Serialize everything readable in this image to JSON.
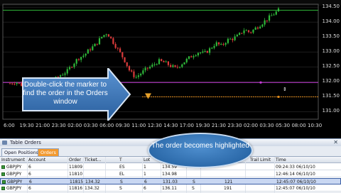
{
  "chart_data": {
    "type": "candlestick",
    "y_ticks": [
      "134.50",
      "134.00",
      "133.50",
      "133.00",
      "132.50",
      "132.00",
      "131.50",
      "131.00"
    ],
    "x_ticks": [
      "6:00",
      "19:30",
      "21:00",
      "23:30",
      "02:00",
      "03:30",
      "06:00",
      "09:30",
      "11:00",
      "12:30",
      "14:30",
      "17:00",
      "19:30",
      "21:30",
      "23:30",
      "02:00",
      "03:30",
      "05:30",
      "08:00",
      "10:30"
    ],
    "close_path": [
      131.95,
      132.0,
      131.9,
      131.85,
      131.95,
      132.05,
      131.9,
      131.85,
      132.1,
      132.25,
      132.35,
      132.6,
      132.8,
      132.9,
      133.1,
      133.25,
      133.5,
      133.65,
      133.35,
      133.05,
      132.75,
      132.35,
      132.15,
      132.3,
      132.45,
      132.55,
      132.7,
      132.65,
      132.55,
      132.45,
      132.6,
      132.75,
      132.9,
      133.0,
      132.95,
      133.1,
      133.3,
      133.2,
      133.4,
      133.45,
      133.55,
      133.75,
      133.65,
      133.8,
      133.95,
      134.1,
      134.25,
      134.4
    ],
    "order_marker_price": 131.5,
    "order_line_price": 131.5,
    "pink_line_price": 131.98,
    "green_line_price": 134.4,
    "colors": {
      "up": "#2fb83a",
      "down": "#d93b3b",
      "order_line": "#e08a1a",
      "pink_line": "#c63ad8",
      "green_line": "#2fb83a",
      "marker": "#e6a12b"
    }
  },
  "panel": {
    "title": "Table Orders",
    "tabs": [
      "Open Positions",
      "Orders"
    ],
    "active_tab": "Orders",
    "columns": [
      "Instrument",
      "Account",
      "Order",
      "Ticket...",
      "T",
      "Lot",
      "",
      "",
      "",
      "",
      "",
      "Trail Limit",
      "Time"
    ],
    "rows": [
      {
        "instrument": "GBPJPY",
        "account": "6",
        "order": "11809",
        "ticket": "",
        "type": "ES",
        "lot": "1",
        "price": "134.59",
        "side": "",
        "extra": "",
        "time": "09:24:33 06/10/10",
        "highlight": false
      },
      {
        "instrument": "GBPJPY",
        "account": "6",
        "order": "11810",
        "ticket": "",
        "type": "EL",
        "lot": "1",
        "price": "134.98",
        "side": "",
        "extra": "",
        "time": "12:46:14 06/10/10",
        "highlight": false
      },
      {
        "instrument": "GBPJPY",
        "account": "6",
        "order": "11815",
        "ticket": "134.32",
        "type": "S",
        "lot": "6",
        "price": "131.03",
        "side": "S",
        "extra": "121",
        "time": "12:45:07 06/10/10",
        "highlight": true
      },
      {
        "instrument": "GBPJPY",
        "account": "6",
        "order": "11816",
        "ticket": "134.32",
        "type": "S",
        "lot": "6",
        "price": "136.11",
        "side": "S",
        "extra": "191",
        "time": "12:45:07 06/10/10",
        "highlight": false
      }
    ]
  },
  "callouts": {
    "marker_hint": "Double-click the marker to find the order in the Orders window",
    "highlight_hint": "The order becomes highlighted"
  }
}
